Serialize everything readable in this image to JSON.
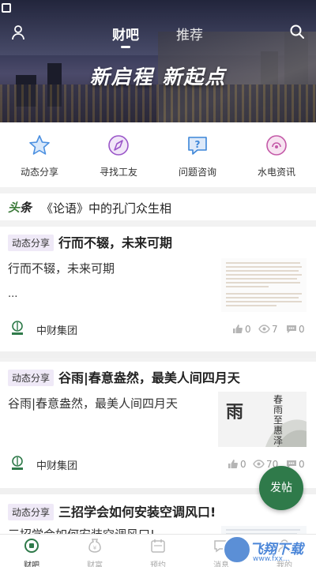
{
  "top_nav": {
    "tabs": [
      {
        "label": "财吧",
        "active": true
      },
      {
        "label": "推荐",
        "active": false
      }
    ],
    "icons": {
      "left": "user-icon",
      "right": "search-icon"
    }
  },
  "banner": {
    "slogan": "新启程  新起点"
  },
  "quick_actions": [
    {
      "label": "动态分享",
      "icon": "star-icon",
      "color": "#4a8fe0"
    },
    {
      "label": "寻找工友",
      "icon": "compass-icon",
      "color": "#9b57c9"
    },
    {
      "label": "问题咨询",
      "icon": "chat-question-icon",
      "color": "#3d86d8"
    },
    {
      "label": "水电资讯",
      "icon": "info-bubble-icon",
      "color": "#c45aa8"
    }
  ],
  "headline": {
    "tag_a": "头",
    "tag_b": "条",
    "text": "《论语》中的孔门众生相"
  },
  "feed": [
    {
      "badge": "动态分享",
      "title": "行而不辍，未来可期",
      "summary": "行而不辍，未来可期",
      "more": "...",
      "author": "中财集团",
      "likes": "0",
      "views": "7",
      "comments": "0"
    },
    {
      "badge": "动态分享",
      "title": "谷雨|春意盎然，最美人间四月天",
      "summary": "谷雨|春意盎然，最美人间四月天",
      "author": "中财集团",
      "likes": "0",
      "views": "70",
      "comments": "0",
      "thumb_char": "雨",
      "thumb_poem": "春雨至惠泽来"
    },
    {
      "badge": "动态分享",
      "title": "三招学会如何安装空调风口!",
      "summary": "三招学会如何安装空调风口!"
    }
  ],
  "fab_label": "发帖",
  "bottom_nav": [
    {
      "label": "财吧",
      "icon": "home-icon",
      "active": true
    },
    {
      "label": "财富",
      "icon": "wealth-icon",
      "active": false
    },
    {
      "label": "预约",
      "icon": "calendar-icon",
      "active": false
    },
    {
      "label": "消息",
      "icon": "message-icon",
      "active": false
    },
    {
      "label": "我的",
      "icon": "profile-icon",
      "active": false
    }
  ],
  "watermark": {
    "text": "飞翔下载",
    "sub": "www.fxx..."
  },
  "colors": {
    "brand_green": "#2f7a4a",
    "badge_bg": "#efe9f7"
  }
}
